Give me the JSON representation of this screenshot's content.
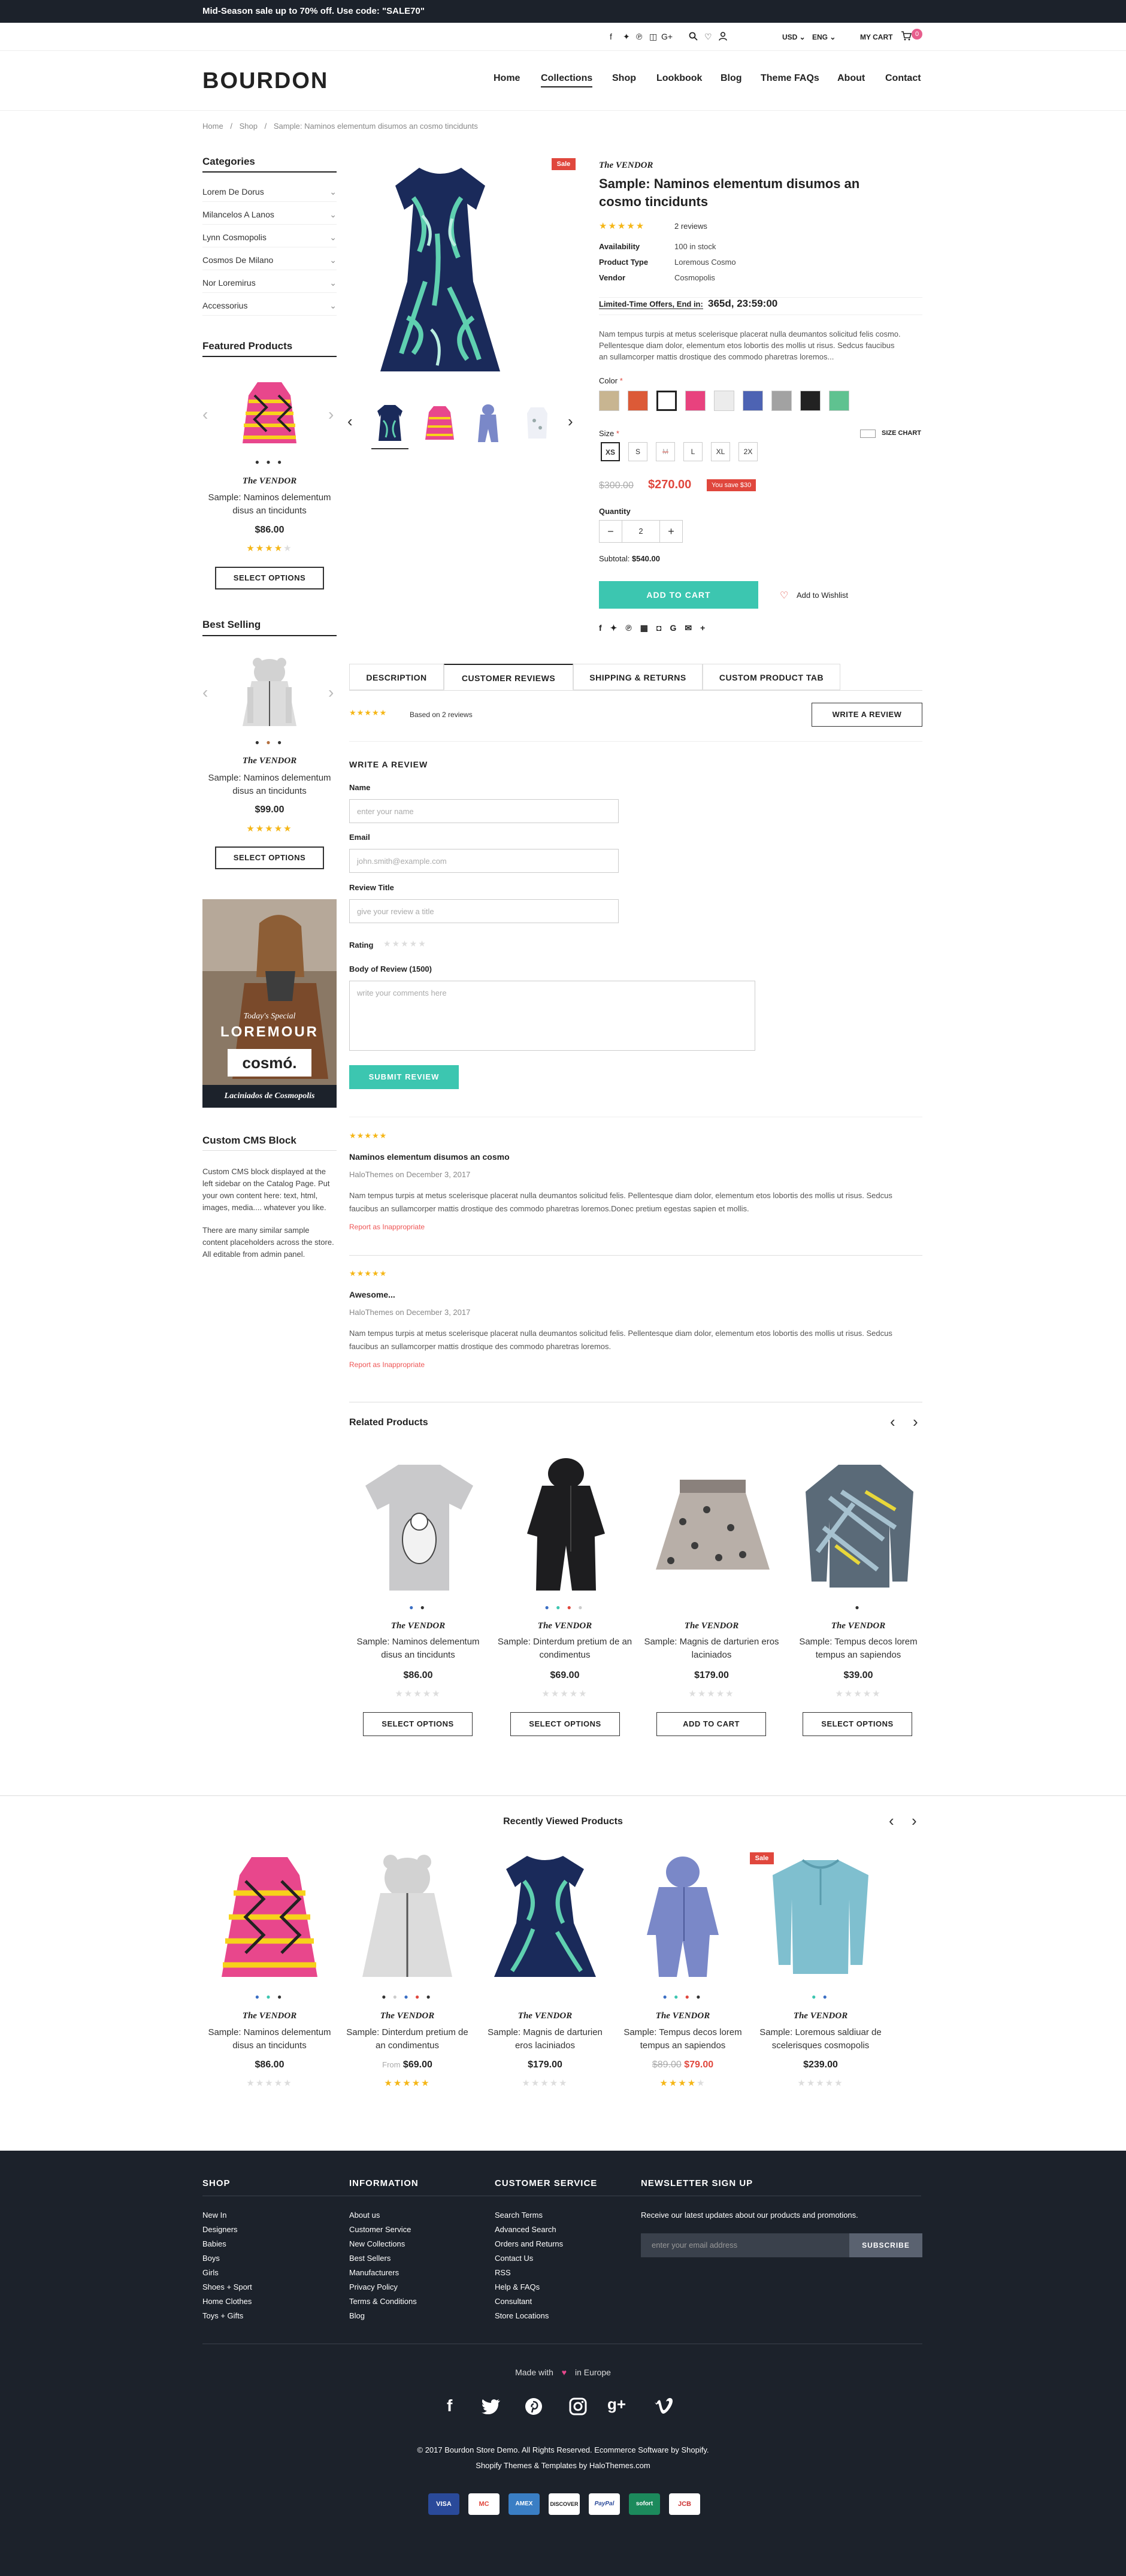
{
  "promo": "Mid-Season sale up to 70% off. Use code: \"SALE70\"",
  "util": {
    "currency": "USD",
    "language": "ENG",
    "cart_label": "MY CART",
    "cart_count": "0"
  },
  "logo": "BOURDON",
  "nav": [
    "Home",
    "Collections",
    "Shop",
    "Lookbook",
    "Blog",
    "Theme FAQs",
    "About",
    "Contact"
  ],
  "breadcrumb": [
    "Home",
    "Shop",
    "Sample: Naminos elementum disumos an cosmo tincidunts"
  ],
  "sidebar": {
    "categories_title": "Categories",
    "categories": [
      "Lorem De Dorus",
      "Milancelos A Lanos",
      "Lynn Cosmopolis",
      "Cosmos De Milano",
      "Nor Loremirus",
      "Accessorius"
    ],
    "featured_title": "Featured Products",
    "featured": {
      "vendor": "The VENDOR",
      "name": "Sample: Naminos delementum disus an tincidunts",
      "price": "$86.00",
      "rating": 4,
      "button": "SELECT OPTIONS"
    },
    "best_title": "Best Selling",
    "best": {
      "vendor": "The VENDOR",
      "name": "Sample: Naminos delementum disus an tincidunts",
      "price": "$99.00",
      "rating": 5,
      "button": "SELECT OPTIONS"
    },
    "banner": {
      "subtitle": "Today's Special",
      "title": "LOREMOUR",
      "brand": "cosmó.",
      "caption": "Laciniados de Cosmopolis"
    },
    "cms_title": "Custom CMS Block",
    "cms_text_1": "Custom CMS block displayed at the left sidebar on the Catalog Page. Put your own content here: text, html, images, media.... whatever you like.",
    "cms_text_2": "There are many similar sample content placeholders across the store. All editable from admin panel."
  },
  "product": {
    "sale_badge": "Sale",
    "vendor": "The VENDOR",
    "title": "Sample: Naminos elementum disumos an cosmo tincidunts",
    "rating": 5,
    "reviews": "2 reviews",
    "info": [
      {
        "label": "Availability",
        "value": "100 in stock"
      },
      {
        "label": "Product Type",
        "value": "Loremous Cosmo"
      },
      {
        "label": "Vendor",
        "value": "Cosmopolis"
      }
    ],
    "offer_label": "Limited-Time Offers, End in:",
    "countdown": "365d, 23:59:00",
    "description": "Nam tempus turpis at metus scelerisque placerat nulla deumantos solicitud felis cosmo. Pellentesque diam dolor, elementum etos lobortis des mollis ut risus. Sedcus faucibus an sullamcorper mattis drostique des commodo pharetras loremos...",
    "color_label": "Color",
    "colors": [
      "#c8b591",
      "#dc5a37",
      "#ffffff",
      "#e8427e",
      "#ececec",
      "#4d63b3",
      "#a2a2a2",
      "#222222",
      "#5fc290"
    ],
    "size_chart": "SIZE CHART",
    "size_label": "Size",
    "sizes": [
      "XS",
      "S",
      "M",
      "L",
      "XL",
      "2X"
    ],
    "old_price": "$300.00",
    "price": "$270.00",
    "save": "You save $30",
    "quantity_label": "Quantity",
    "quantity": "2",
    "subtotal_label": "Subtotal:",
    "subtotal": "$540.00",
    "add_to_cart": "ADD TO CART",
    "wishlist": "Add to Wishlist"
  },
  "tabs": [
    "DESCRIPTION",
    "CUSTOMER REVIEWS",
    "SHIPPING & RETURNS",
    "CUSTOM PRODUCT TAB"
  ],
  "reviews_summary": {
    "based_on": "Based on 2 reviews",
    "write_button": "WRITE A REVIEW"
  },
  "form": {
    "heading": "WRITE A REVIEW",
    "name_label": "Name",
    "name_placeholder": "enter your name",
    "email_label": "Email",
    "email_placeholder": "john.smith@example.com",
    "title_label": "Review Title",
    "title_placeholder": "give your review a title",
    "rating_label": "Rating",
    "body_label": "Body of Review (1500)",
    "body_placeholder": "write your comments here",
    "submit": "SUBMIT REVIEW"
  },
  "reviews": [
    {
      "title": "Naminos elementum disumos an cosmo",
      "meta": "HaloThemes on December 3, 2017",
      "body": "Nam tempus turpis at metus scelerisque placerat nulla deumantos solicitud felis. Pellentesque diam dolor, elementum etos lobortis des mollis ut risus. Sedcus faucibus an sullamcorper mattis drostique des commodo pharetras loremos.Donec pretium egestas sapien et mollis.",
      "report": "Report as Inappropriate"
    },
    {
      "title": "Awesome...",
      "meta": "HaloThemes on December 3, 2017",
      "body": "Nam tempus turpis at metus scelerisque placerat nulla deumantos solicitud felis. Pellentesque diam dolor, elementum etos lobortis des mollis ut risus. Sedcus faucibus an sullamcorper mattis drostique des commodo pharetras loremos.",
      "report": "Report as Inappropriate"
    }
  ],
  "related": {
    "title": "Related Products",
    "items": [
      {
        "vendor": "The VENDOR",
        "name": "Sample: Naminos delementum disus an tincidunts",
        "price": "$86.00",
        "button": "SELECT OPTIONS"
      },
      {
        "vendor": "The VENDOR",
        "name": "Sample: Dinterdum pretium de an condimentus",
        "price": "$69.00",
        "button": "SELECT OPTIONS"
      },
      {
        "vendor": "The VENDOR",
        "name": "Sample: Magnis de darturien eros laciniados",
        "price": "$179.00",
        "button": "ADD TO CART"
      },
      {
        "vendor": "The VENDOR",
        "name": "Sample: Tempus decos lorem tempus an sapiendos",
        "price": "$39.00",
        "button": "SELECT OPTIONS"
      }
    ]
  },
  "recent": {
    "title": "Recently Viewed Products",
    "sale_badge": "Sale",
    "items": [
      {
        "vendor": "The VENDOR",
        "name": "Sample: Naminos delementum disus an tincidunts",
        "price": "$86.00",
        "rating": 0
      },
      {
        "vendor": "The VENDOR",
        "name": "Sample: Dinterdum pretium de an condimentus",
        "price_from": "From",
        "price": "$69.00",
        "rating": 5
      },
      {
        "vendor": "The VENDOR",
        "name": "Sample: Magnis de darturien eros laciniados",
        "price": "$179.00",
        "rating": 0
      },
      {
        "vendor": "The VENDOR",
        "name": "Sample: Tempus decos lorem tempus an sapiendos",
        "old_price": "$89.00",
        "price": "$79.00",
        "rating": 4
      },
      {
        "vendor": "The VENDOR",
        "name": "Sample: Loremous saldiuar de scelerisques cosmopolis",
        "price": "$239.00",
        "rating": 0
      }
    ]
  },
  "footer": {
    "shop_title": "SHOP",
    "shop": [
      "New In",
      "Designers",
      "Babies",
      "Boys",
      "Girls",
      "Shoes + Sport",
      "Home Clothes",
      "Toys + Gifts"
    ],
    "info_title": "INFORMATION",
    "info": [
      "About us",
      "Customer Service",
      "New Collections",
      "Best Sellers",
      "Manufacturers",
      "Privacy Policy",
      "Terms & Conditions",
      "Blog"
    ],
    "service_title": "CUSTOMER SERVICE",
    "service": [
      "Search Terms",
      "Advanced Search",
      "Orders and Returns",
      "Contact Us",
      "RSS",
      "Help & FAQs",
      "Consultant",
      "Store Locations"
    ],
    "newsletter_title": "NEWSLETTER SIGN UP",
    "newsletter_text": "Receive our latest updates about our products and promotions.",
    "newsletter_placeholder": "enter your email address",
    "subscribe": "SUBSCRIBE",
    "made_with": "Made with",
    "in_europe": "in Europe",
    "copyright": "© 2017 Bourdon Store Demo. All Rights Reserved. Ecommerce Software by Shopify.",
    "credits": "Shopify Themes & Templates by HaloThemes.com",
    "payments": [
      "VISA",
      "MC",
      "AMEX",
      "DISCOVER",
      "PayPal",
      "sofort",
      "JCB"
    ]
  }
}
